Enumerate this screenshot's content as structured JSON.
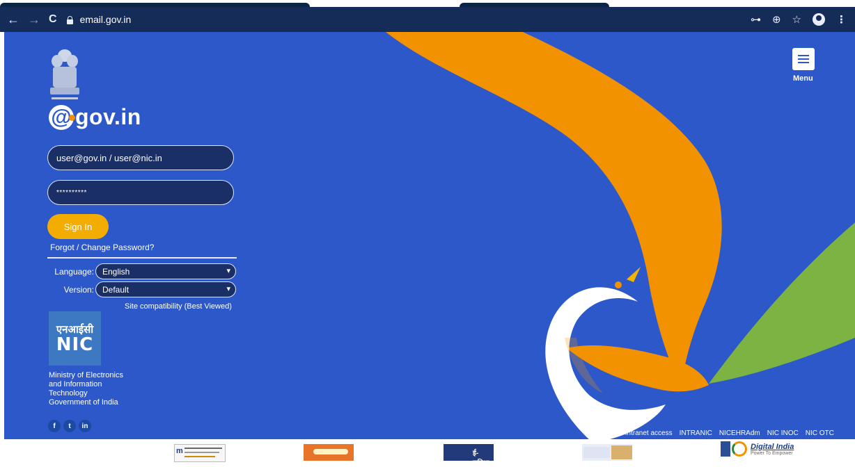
{
  "browser": {
    "url": "email.gov.in",
    "back_icon": "←",
    "forward_icon": "→",
    "reload_icon": "C",
    "key_icon": "⊶",
    "zoom_icon": "⊕",
    "bookmark_icon": "☆",
    "more_icon": "⋮"
  },
  "brand": {
    "at": "@",
    "name": "gov.in",
    "emblem_motto": "सत्यमेव जयते"
  },
  "login": {
    "username_placeholder": "user@gov.in / user@nic.in",
    "password_value": "**********",
    "signin_label": "Sign In",
    "forgot_label": "Forgot / Change Password?",
    "language_label": "Language:",
    "language_value": "English",
    "version_label": "Version:",
    "version_value": "Default",
    "compat_label": "Site compatibility (Best Viewed)"
  },
  "nic": {
    "hindi": "एनआईसी",
    "english": "NIC",
    "ministry": "Ministry of Electronics and Information Technology Government of India"
  },
  "social": {
    "facebook": "f",
    "twitter": "t",
    "linkedin": "in"
  },
  "menu": {
    "label": "Menu"
  },
  "intranet": {
    "label": "For Intranet access",
    "links": [
      "INTRANIC",
      "NICEHRAdm",
      "NIC INOC",
      "NIC OTC"
    ]
  },
  "footer": {
    "digital_india": "Digital India",
    "digital_india_tagline": "Power To Empower",
    "esuvidha": "ई-सुविधा"
  },
  "colors": {
    "page_bg": "#2c58c9",
    "chrome_bg": "#162c58",
    "orange": "#f39200",
    "green": "#7cb342",
    "signin": "#f2ad00"
  }
}
